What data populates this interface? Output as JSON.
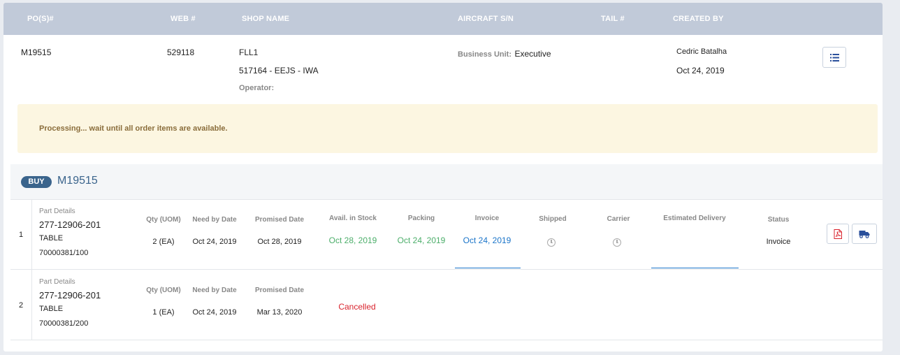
{
  "header": {
    "columns": [
      "PO(S)#",
      "WEB #",
      "SHOP NAME",
      "AIRCRAFT S/N",
      "TAIL #",
      "CREATED BY"
    ]
  },
  "po": {
    "po_number": "M19515",
    "web_number": "529118",
    "shop_name": "FLL1",
    "shop_detail": "517164 - EEJS - IWA",
    "operator_label": "Operator:",
    "business_unit_label": "Business Unit:",
    "business_unit_value": "Executive",
    "created_by": "Cedric Batalha",
    "created_date": "Oct 24, 2019",
    "list_icon": "list-icon"
  },
  "alert": {
    "message": "Processing... wait until all order items are available."
  },
  "order": {
    "badge": "BUY",
    "id": "M19515"
  },
  "labels": {
    "part_details": "Part Details",
    "qty": "Qty (UOM)",
    "need_by": "Need by Date",
    "promised": "Promised Date",
    "avail_stock": "Avail. in Stock",
    "packing": "Packing",
    "invoice": "Invoice",
    "shipped": "Shipped",
    "carrier": "Carrier",
    "est_delivery": "Estimated Delivery",
    "status": "Status"
  },
  "items": [
    {
      "index": "1",
      "part_number": "277-12906-201",
      "description": "TABLE",
      "ref": "70000381/100",
      "qty": "2 (EA)",
      "need_by": "Oct 24, 2019",
      "promised": "Oct 28, 2019",
      "avail_stock": "Oct 28, 2019",
      "packing": "Oct 24, 2019",
      "invoice": "Oct 24, 2019",
      "status": "Invoice",
      "pdf_icon": "pdf-icon",
      "truck_icon": "truck-icon"
    },
    {
      "index": "2",
      "part_number": "277-12906-201",
      "description": "TABLE",
      "ref": "70000381/200",
      "qty": "1 (EA)",
      "need_by": "Oct 24, 2019",
      "promised": "Mar 13, 2020",
      "state": "Cancelled"
    }
  ],
  "colors": {
    "header_bg": "#c1cad9",
    "accent": "#3a648c",
    "green": "#4cae6a",
    "blue": "#1b75c9",
    "red": "#d9232d",
    "alert_bg": "#fcf6e1"
  }
}
